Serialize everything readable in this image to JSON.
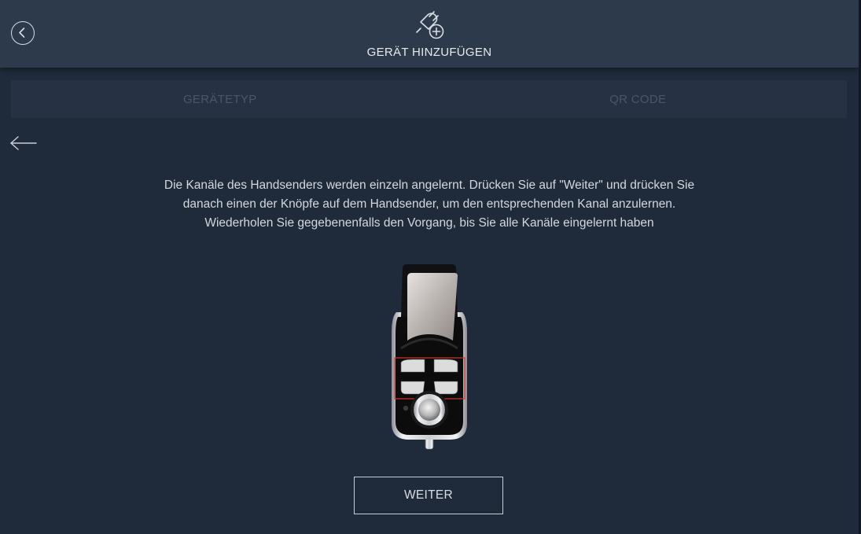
{
  "header": {
    "title": "GERÄT HINZUFÜGEN",
    "back_icon": "chevron-left-circle-icon",
    "title_icon": "plug-add-icon"
  },
  "tabs": [
    {
      "label": "GERÄTETYP"
    },
    {
      "label": "QR CODE"
    }
  ],
  "nav": {
    "back_icon": "arrow-left-icon"
  },
  "instructions": {
    "line1": "Die Kanäle des Handsenders werden einzeln angelernt. Drücken Sie auf \"Weiter\" und drücken Sie",
    "line2": "danach einen der Knöpfe auf dem Handsender, um den entsprechenden Kanal anzulernen.",
    "line3": "Wiederholen Sie gegebenenfalls den Vorgang, bis Sie alle Kanäle eingelernt haben"
  },
  "device_image": {
    "icon": "remote-control-image",
    "highlight_color": "#d9342b"
  },
  "actions": {
    "next_label": "WEITER"
  },
  "colors": {
    "background": "#1f2a3a",
    "header": "#2d3a4c",
    "tab_bar": "#263244",
    "tab_text": "#4a5769",
    "text": "#d3d8df"
  }
}
